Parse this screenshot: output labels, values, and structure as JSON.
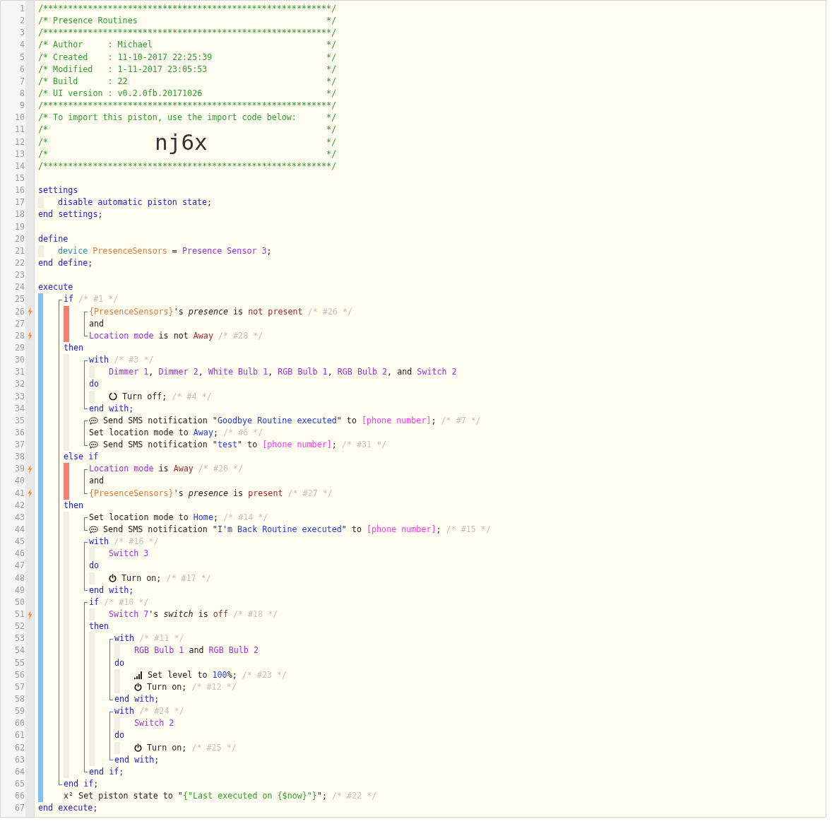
{
  "lines": [
    {
      "n": "1",
      "flash": false,
      "kind": "code",
      "tokens": [
        {
          "kind": "head",
          "text": "/**********************************************************/"
        }
      ]
    },
    {
      "n": "2",
      "flash": false,
      "kind": "banner",
      "tokens": [
        {
          "kind": "head",
          "text": "/* Presence Routines"
        },
        {
          "kind": "head",
          "text": "*/"
        }
      ]
    },
    {
      "n": "3",
      "flash": false,
      "kind": "code",
      "tokens": [
        {
          "kind": "head",
          "text": "/**********************************************************/"
        }
      ]
    },
    {
      "n": "4",
      "flash": false,
      "kind": "banner",
      "tokens": [
        {
          "kind": "head",
          "text": "/* Author     : Michael"
        },
        {
          "kind": "head",
          "text": "*/"
        }
      ]
    },
    {
      "n": "5",
      "flash": false,
      "kind": "banner",
      "tokens": [
        {
          "kind": "head",
          "text": "/* Created    : 11-10-2017 22:25:39"
        },
        {
          "kind": "head",
          "text": "*/"
        }
      ]
    },
    {
      "n": "6",
      "flash": false,
      "kind": "banner",
      "tokens": [
        {
          "kind": "head",
          "text": "/* Modified   : 1-11-2017 23:05:53"
        },
        {
          "kind": "head",
          "text": "*/"
        }
      ]
    },
    {
      "n": "7",
      "flash": false,
      "kind": "banner",
      "tokens": [
        {
          "kind": "head",
          "text": "/* Build      : 22"
        },
        {
          "kind": "head",
          "text": "*/"
        }
      ]
    },
    {
      "n": "8",
      "flash": false,
      "kind": "banner",
      "tokens": [
        {
          "kind": "head",
          "text": "/* UI version : v0.2.0fb.20171026"
        },
        {
          "kind": "head",
          "text": "*/"
        }
      ]
    },
    {
      "n": "9",
      "flash": false,
      "kind": "code",
      "tokens": [
        {
          "kind": "head",
          "text": "/**********************************************************/"
        }
      ]
    },
    {
      "n": "10",
      "flash": false,
      "kind": "banner",
      "tokens": [
        {
          "kind": "head",
          "text": "/* To import this piston, use the import code below:"
        },
        {
          "kind": "head",
          "text": "*/"
        }
      ]
    },
    {
      "n": "11",
      "flash": false,
      "kind": "banner",
      "tokens": [
        {
          "kind": "head",
          "text": "/*"
        },
        {
          "kind": "head",
          "text": "*/"
        }
      ]
    },
    {
      "n": "12",
      "flash": false,
      "kind": "banner",
      "tokens": [
        {
          "kind": "head",
          "text": "/*"
        },
        {
          "kind": "big",
          "text": "nj6x"
        },
        {
          "kind": "head",
          "text": "*/"
        }
      ]
    },
    {
      "n": "13",
      "flash": false,
      "kind": "banner",
      "tokens": [
        {
          "kind": "head",
          "text": "/*"
        },
        {
          "kind": "head",
          "text": "*/"
        }
      ]
    },
    {
      "n": "14",
      "flash": false,
      "kind": "code",
      "tokens": [
        {
          "kind": "head",
          "text": "/**********************************************************/"
        }
      ]
    },
    {
      "n": "15",
      "flash": false,
      "kind": "code"
    },
    {
      "n": "16",
      "flash": false,
      "kind": "code",
      "tokens": [
        {
          "kind": "kw",
          "text": "settings"
        }
      ]
    },
    {
      "n": "17",
      "flash": false,
      "kind": "code",
      "guides": [
        {
          "kind": "block"
        }
      ],
      "tokens": [
        {
          "kind": "kw",
          "text": "disable automatic piston state"
        },
        {
          "kind": "plain",
          "text": ";"
        }
      ]
    },
    {
      "n": "18",
      "flash": false,
      "kind": "code",
      "tokens": [
        {
          "kind": "kw",
          "text": "end settings;"
        }
      ]
    },
    {
      "n": "19",
      "flash": false,
      "kind": "code"
    },
    {
      "n": "20",
      "flash": false,
      "kind": "code",
      "tokens": [
        {
          "kind": "kw",
          "text": "define"
        }
      ]
    },
    {
      "n": "21",
      "flash": false,
      "kind": "code",
      "guides": [
        {
          "kind": "block"
        }
      ],
      "tokens": [
        {
          "kind": "type",
          "text": "device"
        },
        {
          "kind": "var",
          "text": " PresenceSensors"
        },
        {
          "kind": "plain",
          "text": " = "
        },
        {
          "kind": "dev",
          "text": "Presence Sensor 3"
        },
        {
          "kind": "plain",
          "text": ";"
        }
      ]
    },
    {
      "n": "22",
      "flash": false,
      "kind": "code",
      "tokens": [
        {
          "kind": "kw",
          "text": "end define;"
        }
      ]
    },
    {
      "n": "23",
      "flash": false,
      "kind": "code"
    },
    {
      "n": "24",
      "flash": false,
      "kind": "code",
      "tokens": [
        {
          "kind": "kw",
          "text": "execute"
        }
      ]
    },
    {
      "n": "25",
      "flash": false,
      "kind": "code",
      "guides": [
        {
          "kind": "exec"
        },
        {
          "kind": "open"
        }
      ],
      "tokens": [
        {
          "kind": "kw",
          "text": "if"
        },
        {
          "kind": "note",
          "text": " /* #1 */"
        }
      ]
    },
    {
      "n": "26",
      "flash": true,
      "kind": "code",
      "guides": [
        {
          "kind": "exec"
        },
        {
          "kind": "line"
        },
        {
          "kind": "cond"
        },
        {
          "kind": "open"
        }
      ],
      "tokens": [
        {
          "kind": "var",
          "text": "{PresenceSensors}"
        },
        {
          "kind": "plain",
          "text": "'s "
        },
        {
          "kind": "attr",
          "text": "presence"
        },
        {
          "kind": "plain",
          "text": " is "
        },
        {
          "kind": "val",
          "text": "not present"
        },
        {
          "kind": "note",
          "text": " /* #26 */"
        }
      ]
    },
    {
      "n": "27",
      "flash": false,
      "kind": "code",
      "guides": [
        {
          "kind": "exec"
        },
        {
          "kind": "line"
        },
        {
          "kind": "cond"
        },
        {
          "kind": "line"
        }
      ],
      "tokens": [
        {
          "kind": "plain",
          "text": "and"
        }
      ]
    },
    {
      "n": "28",
      "flash": true,
      "kind": "code",
      "guides": [
        {
          "kind": "exec"
        },
        {
          "kind": "line"
        },
        {
          "kind": "cond"
        },
        {
          "kind": "close"
        }
      ],
      "tokens": [
        {
          "kind": "dev",
          "text": "Location mode"
        },
        {
          "kind": "plain",
          "text": " is not "
        },
        {
          "kind": "val",
          "text": "Away"
        },
        {
          "kind": "note",
          "text": " /* #28 */"
        }
      ]
    },
    {
      "n": "29",
      "flash": false,
      "kind": "code",
      "guides": [
        {
          "kind": "exec"
        },
        {
          "kind": "line"
        }
      ],
      "tokens": [
        {
          "kind": "kw",
          "text": "then"
        }
      ]
    },
    {
      "n": "30",
      "flash": false,
      "kind": "code",
      "guides": [
        {
          "kind": "exec"
        },
        {
          "kind": "line"
        },
        {
          "kind": "block"
        },
        {
          "kind": "open"
        }
      ],
      "tokens": [
        {
          "kind": "kw",
          "text": "with"
        },
        {
          "kind": "note",
          "text": " /* #3 */"
        }
      ]
    },
    {
      "n": "31",
      "flash": false,
      "kind": "code",
      "guides": [
        {
          "kind": "exec"
        },
        {
          "kind": "line"
        },
        {
          "kind": "block"
        },
        {
          "kind": "line"
        },
        {
          "kind": "block"
        }
      ],
      "tokens": [
        {
          "kind": "dev",
          "text": "Dimmer 1"
        },
        {
          "kind": "plain",
          "text": ", "
        },
        {
          "kind": "dev",
          "text": "Dimmer 2"
        },
        {
          "kind": "plain",
          "text": ", "
        },
        {
          "kind": "dev",
          "text": "White Bulb 1"
        },
        {
          "kind": "plain",
          "text": ", "
        },
        {
          "kind": "dev",
          "text": "RGB Bulb 1"
        },
        {
          "kind": "plain",
          "text": ", "
        },
        {
          "kind": "dev",
          "text": "RGB Bulb 2"
        },
        {
          "kind": "plain",
          "text": ", and "
        },
        {
          "kind": "dev",
          "text": "Switch 2"
        }
      ]
    },
    {
      "n": "32",
      "flash": false,
      "kind": "code",
      "guides": [
        {
          "kind": "exec"
        },
        {
          "kind": "line"
        },
        {
          "kind": "block"
        },
        {
          "kind": "line"
        }
      ],
      "tokens": [
        {
          "kind": "kw",
          "text": "do"
        }
      ]
    },
    {
      "n": "33",
      "flash": false,
      "kind": "code",
      "guides": [
        {
          "kind": "exec"
        },
        {
          "kind": "line"
        },
        {
          "kind": "block"
        },
        {
          "kind": "line"
        },
        {
          "kind": "block"
        }
      ],
      "tokens": [
        {
          "kind": "ring"
        },
        {
          "kind": "plain",
          "text": " Turn off;"
        },
        {
          "kind": "note",
          "text": " /* #4 */"
        }
      ]
    },
    {
      "n": "34",
      "flash": false,
      "kind": "code",
      "guides": [
        {
          "kind": "exec"
        },
        {
          "kind": "line"
        },
        {
          "kind": "block"
        },
        {
          "kind": "close"
        }
      ],
      "tokens": [
        {
          "kind": "kw",
          "text": "end with;"
        }
      ]
    },
    {
      "n": "35",
      "flash": false,
      "kind": "code",
      "guides": [
        {
          "kind": "exec"
        },
        {
          "kind": "line"
        },
        {
          "kind": "block"
        },
        {
          "kind": "open"
        }
      ],
      "tokens": [
        {
          "kind": "chat"
        },
        {
          "kind": "plain",
          "text": " Send SMS notification \""
        },
        {
          "kind": "const",
          "text": "Goodbye Routine executed"
        },
        {
          "kind": "plain",
          "text": "\" to "
        },
        {
          "kind": "param",
          "text": "[phone number]"
        },
        {
          "kind": "plain",
          "text": ";"
        },
        {
          "kind": "note",
          "text": " /* #7 */"
        }
      ]
    },
    {
      "n": "36",
      "flash": false,
      "kind": "code",
      "guides": [
        {
          "kind": "exec"
        },
        {
          "kind": "line"
        },
        {
          "kind": "block"
        },
        {
          "kind": "line"
        }
      ],
      "tokens": [
        {
          "kind": "plain",
          "text": "Set location mode to "
        },
        {
          "kind": "const",
          "text": "Away"
        },
        {
          "kind": "plain",
          "text": ";"
        },
        {
          "kind": "note",
          "text": " /* #6 */"
        }
      ]
    },
    {
      "n": "37",
      "flash": false,
      "kind": "code",
      "guides": [
        {
          "kind": "exec"
        },
        {
          "kind": "line"
        },
        {
          "kind": "block"
        },
        {
          "kind": "close"
        }
      ],
      "tokens": [
        {
          "kind": "chat"
        },
        {
          "kind": "plain",
          "text": " Send SMS notification \""
        },
        {
          "kind": "const",
          "text": "test"
        },
        {
          "kind": "plain",
          "text": "\" to "
        },
        {
          "kind": "param",
          "text": "[phone number]"
        },
        {
          "kind": "plain",
          "text": ";"
        },
        {
          "kind": "note",
          "text": " /* #31 */"
        }
      ]
    },
    {
      "n": "38",
      "flash": false,
      "kind": "code",
      "guides": [
        {
          "kind": "exec"
        },
        {
          "kind": "line"
        }
      ],
      "tokens": [
        {
          "kind": "kw",
          "text": "else if"
        }
      ]
    },
    {
      "n": "39",
      "flash": true,
      "kind": "code",
      "guides": [
        {
          "kind": "exec"
        },
        {
          "kind": "line"
        },
        {
          "kind": "cond"
        },
        {
          "kind": "open"
        }
      ],
      "tokens": [
        {
          "kind": "dev",
          "text": "Location mode"
        },
        {
          "kind": "plain",
          "text": " is "
        },
        {
          "kind": "val",
          "text": "Away"
        },
        {
          "kind": "note",
          "text": " /* #20 */"
        }
      ]
    },
    {
      "n": "40",
      "flash": false,
      "kind": "code",
      "guides": [
        {
          "kind": "exec"
        },
        {
          "kind": "line"
        },
        {
          "kind": "cond"
        },
        {
          "kind": "line"
        }
      ],
      "tokens": [
        {
          "kind": "plain",
          "text": "and"
        }
      ]
    },
    {
      "n": "41",
      "flash": true,
      "kind": "code",
      "guides": [
        {
          "kind": "exec"
        },
        {
          "kind": "line"
        },
        {
          "kind": "cond"
        },
        {
          "kind": "close"
        }
      ],
      "tokens": [
        {
          "kind": "var",
          "text": "{PresenceSensors}"
        },
        {
          "kind": "plain",
          "text": "'s "
        },
        {
          "kind": "attr",
          "text": "presence"
        },
        {
          "kind": "plain",
          "text": " is "
        },
        {
          "kind": "val",
          "text": "present"
        },
        {
          "kind": "note",
          "text": " /* #27 */"
        }
      ]
    },
    {
      "n": "42",
      "flash": false,
      "kind": "code",
      "guides": [
        {
          "kind": "exec"
        },
        {
          "kind": "line"
        }
      ],
      "tokens": [
        {
          "kind": "kw",
          "text": "then"
        }
      ]
    },
    {
      "n": "43",
      "flash": false,
      "kind": "code",
      "guides": [
        {
          "kind": "exec"
        },
        {
          "kind": "line"
        },
        {
          "kind": "block"
        },
        {
          "kind": "open"
        }
      ],
      "tokens": [
        {
          "kind": "plain",
          "text": "Set location mode to "
        },
        {
          "kind": "const",
          "text": "Home"
        },
        {
          "kind": "plain",
          "text": ";"
        },
        {
          "kind": "note",
          "text": " /* #14 */"
        }
      ]
    },
    {
      "n": "44",
      "flash": false,
      "kind": "code",
      "guides": [
        {
          "kind": "exec"
        },
        {
          "kind": "line"
        },
        {
          "kind": "block"
        },
        {
          "kind": "close"
        }
      ],
      "tokens": [
        {
          "kind": "chat"
        },
        {
          "kind": "plain",
          "text": " Send SMS notification \""
        },
        {
          "kind": "const",
          "text": "I'm Back Routine executed"
        },
        {
          "kind": "plain",
          "text": "\" to "
        },
        {
          "kind": "param",
          "text": "[phone number]"
        },
        {
          "kind": "plain",
          "text": ";"
        },
        {
          "kind": "note",
          "text": " /* #15 */"
        }
      ]
    },
    {
      "n": "45",
      "flash": false,
      "kind": "code",
      "guides": [
        {
          "kind": "exec"
        },
        {
          "kind": "line"
        },
        {
          "kind": "block"
        },
        {
          "kind": "open"
        }
      ],
      "tokens": [
        {
          "kind": "kw",
          "text": "with"
        },
        {
          "kind": "note",
          "text": " /* #16 */"
        }
      ]
    },
    {
      "n": "46",
      "flash": false,
      "kind": "code",
      "guides": [
        {
          "kind": "exec"
        },
        {
          "kind": "line"
        },
        {
          "kind": "block"
        },
        {
          "kind": "line"
        },
        {
          "kind": "block"
        }
      ],
      "tokens": [
        {
          "kind": "dev",
          "text": "Switch 3"
        }
      ]
    },
    {
      "n": "47",
      "flash": false,
      "kind": "code",
      "guides": [
        {
          "kind": "exec"
        },
        {
          "kind": "line"
        },
        {
          "kind": "block"
        },
        {
          "kind": "line"
        }
      ],
      "tokens": [
        {
          "kind": "kw",
          "text": "do"
        }
      ]
    },
    {
      "n": "48",
      "flash": false,
      "kind": "code",
      "guides": [
        {
          "kind": "exec"
        },
        {
          "kind": "line"
        },
        {
          "kind": "block"
        },
        {
          "kind": "line"
        },
        {
          "kind": "block"
        }
      ],
      "tokens": [
        {
          "kind": "power"
        },
        {
          "kind": "plain",
          "text": " Turn on;"
        },
        {
          "kind": "note",
          "text": " /* #17 */"
        }
      ]
    },
    {
      "n": "49",
      "flash": false,
      "kind": "code",
      "guides": [
        {
          "kind": "exec"
        },
        {
          "kind": "line"
        },
        {
          "kind": "block"
        },
        {
          "kind": "close"
        }
      ],
      "tokens": [
        {
          "kind": "kw",
          "text": "end with;"
        }
      ]
    },
    {
      "n": "50",
      "flash": false,
      "kind": "code",
      "guides": [
        {
          "kind": "exec"
        },
        {
          "kind": "line"
        },
        {
          "kind": "block"
        },
        {
          "kind": "open"
        }
      ],
      "tokens": [
        {
          "kind": "kw",
          "text": "if"
        },
        {
          "kind": "note",
          "text": " /* #10 */"
        }
      ]
    },
    {
      "n": "51",
      "flash": true,
      "kind": "code",
      "guides": [
        {
          "kind": "exec"
        },
        {
          "kind": "line"
        },
        {
          "kind": "block"
        },
        {
          "kind": "line"
        },
        {
          "kind": "block"
        }
      ],
      "tokens": [
        {
          "kind": "dev",
          "text": "Switch 7"
        },
        {
          "kind": "plain",
          "text": "'s "
        },
        {
          "kind": "attr",
          "text": "switch"
        },
        {
          "kind": "plain",
          "text": " is "
        },
        {
          "kind": "val",
          "text": "off"
        },
        {
          "kind": "note",
          "text": " /* #18 */"
        }
      ]
    },
    {
      "n": "52",
      "flash": false,
      "kind": "code",
      "guides": [
        {
          "kind": "exec"
        },
        {
          "kind": "line"
        },
        {
          "kind": "block"
        },
        {
          "kind": "line"
        }
      ],
      "tokens": [
        {
          "kind": "kw",
          "text": "then"
        }
      ]
    },
    {
      "n": "53",
      "flash": false,
      "kind": "code",
      "guides": [
        {
          "kind": "exec"
        },
        {
          "kind": "line"
        },
        {
          "kind": "block"
        },
        {
          "kind": "line"
        },
        {
          "kind": "block"
        },
        {
          "kind": "open"
        }
      ],
      "tokens": [
        {
          "kind": "kw",
          "text": "with"
        },
        {
          "kind": "note",
          "text": " /* #11 */"
        }
      ]
    },
    {
      "n": "54",
      "flash": false,
      "kind": "code",
      "guides": [
        {
          "kind": "exec"
        },
        {
          "kind": "line"
        },
        {
          "kind": "block"
        },
        {
          "kind": "line"
        },
        {
          "kind": "block"
        },
        {
          "kind": "line"
        },
        {
          "kind": "block"
        }
      ],
      "tokens": [
        {
          "kind": "dev",
          "text": "RGB Bulb 1"
        },
        {
          "kind": "plain",
          "text": " and "
        },
        {
          "kind": "dev",
          "text": "RGB Bulb 2"
        }
      ]
    },
    {
      "n": "55",
      "flash": false,
      "kind": "code",
      "guides": [
        {
          "kind": "exec"
        },
        {
          "kind": "line"
        },
        {
          "kind": "block"
        },
        {
          "kind": "line"
        },
        {
          "kind": "block"
        },
        {
          "kind": "line"
        }
      ],
      "tokens": [
        {
          "kind": "kw",
          "text": "do"
        }
      ]
    },
    {
      "n": "56",
      "flash": false,
      "kind": "code",
      "guides": [
        {
          "kind": "exec"
        },
        {
          "kind": "line"
        },
        {
          "kind": "block"
        },
        {
          "kind": "line"
        },
        {
          "kind": "block"
        },
        {
          "kind": "line"
        },
        {
          "kind": "block"
        }
      ],
      "tokens": [
        {
          "kind": "bars"
        },
        {
          "kind": "plain",
          "text": " Set level to "
        },
        {
          "kind": "const",
          "text": "100"
        },
        {
          "kind": "plain",
          "text": "%;"
        },
        {
          "kind": "note",
          "text": " /* #23 */"
        }
      ]
    },
    {
      "n": "57",
      "flash": false,
      "kind": "code",
      "guides": [
        {
          "kind": "exec"
        },
        {
          "kind": "line"
        },
        {
          "kind": "block"
        },
        {
          "kind": "line"
        },
        {
          "kind": "block"
        },
        {
          "kind": "line"
        },
        {
          "kind": "block"
        }
      ],
      "tokens": [
        {
          "kind": "power"
        },
        {
          "kind": "plain",
          "text": " Turn on;"
        },
        {
          "kind": "note",
          "text": " /* #12 */"
        }
      ]
    },
    {
      "n": "58",
      "flash": false,
      "kind": "code",
      "guides": [
        {
          "kind": "exec"
        },
        {
          "kind": "line"
        },
        {
          "kind": "block"
        },
        {
          "kind": "line"
        },
        {
          "kind": "block"
        },
        {
          "kind": "close"
        }
      ],
      "tokens": [
        {
          "kind": "kw",
          "text": "end with;"
        }
      ]
    },
    {
      "n": "59",
      "flash": false,
      "kind": "code",
      "guides": [
        {
          "kind": "exec"
        },
        {
          "kind": "line"
        },
        {
          "kind": "block"
        },
        {
          "kind": "line"
        },
        {
          "kind": "block"
        },
        {
          "kind": "open"
        }
      ],
      "tokens": [
        {
          "kind": "kw",
          "text": "with"
        },
        {
          "kind": "note",
          "text": " /* #24 */"
        }
      ]
    },
    {
      "n": "60",
      "flash": false,
      "kind": "code",
      "guides": [
        {
          "kind": "exec"
        },
        {
          "kind": "line"
        },
        {
          "kind": "block"
        },
        {
          "kind": "line"
        },
        {
          "kind": "block"
        },
        {
          "kind": "line"
        },
        {
          "kind": "block"
        }
      ],
      "tokens": [
        {
          "kind": "dev",
          "text": "Switch 2"
        }
      ]
    },
    {
      "n": "61",
      "flash": false,
      "kind": "code",
      "guides": [
        {
          "kind": "exec"
        },
        {
          "kind": "line"
        },
        {
          "kind": "block"
        },
        {
          "kind": "line"
        },
        {
          "kind": "block"
        },
        {
          "kind": "line"
        }
      ],
      "tokens": [
        {
          "kind": "kw",
          "text": "do"
        }
      ]
    },
    {
      "n": "62",
      "flash": false,
      "kind": "code",
      "guides": [
        {
          "kind": "exec"
        },
        {
          "kind": "line"
        },
        {
          "kind": "block"
        },
        {
          "kind": "line"
        },
        {
          "kind": "block"
        },
        {
          "kind": "line"
        },
        {
          "kind": "block"
        }
      ],
      "tokens": [
        {
          "kind": "power"
        },
        {
          "kind": "plain",
          "text": " Turn on;"
        },
        {
          "kind": "note",
          "text": " /* #25 */"
        }
      ]
    },
    {
      "n": "63",
      "flash": false,
      "kind": "code",
      "guides": [
        {
          "kind": "exec"
        },
        {
          "kind": "line"
        },
        {
          "kind": "block"
        },
        {
          "kind": "line"
        },
        {
          "kind": "block"
        },
        {
          "kind": "close"
        }
      ],
      "tokens": [
        {
          "kind": "kw",
          "text": "end with;"
        }
      ]
    },
    {
      "n": "64",
      "flash": false,
      "kind": "code",
      "guides": [
        {
          "kind": "exec"
        },
        {
          "kind": "line"
        },
        {
          "kind": "block"
        },
        {
          "kind": "close"
        }
      ],
      "tokens": [
        {
          "kind": "kw",
          "text": "end if;"
        }
      ]
    },
    {
      "n": "65",
      "flash": false,
      "kind": "code",
      "guides": [
        {
          "kind": "exec"
        },
        {
          "kind": "close"
        }
      ],
      "tokens": [
        {
          "kind": "kw",
          "text": "end if;"
        }
      ]
    },
    {
      "n": "66",
      "flash": false,
      "kind": "code",
      "guides": [
        {
          "kind": "exec"
        },
        {
          "kind": "gap"
        }
      ],
      "tokens": [
        {
          "kind": "plain",
          "text": "x² Set piston state to \""
        },
        {
          "kind": "str",
          "text": "{\"Last executed on {$now}\"}"
        },
        {
          "kind": "plain",
          "text": "\";"
        },
        {
          "kind": "note",
          "text": " /* #22 */"
        }
      ]
    },
    {
      "n": "67",
      "flash": false,
      "kind": "code",
      "tokens": [
        {
          "kind": "kw",
          "text": "end execute;"
        }
      ]
    }
  ]
}
